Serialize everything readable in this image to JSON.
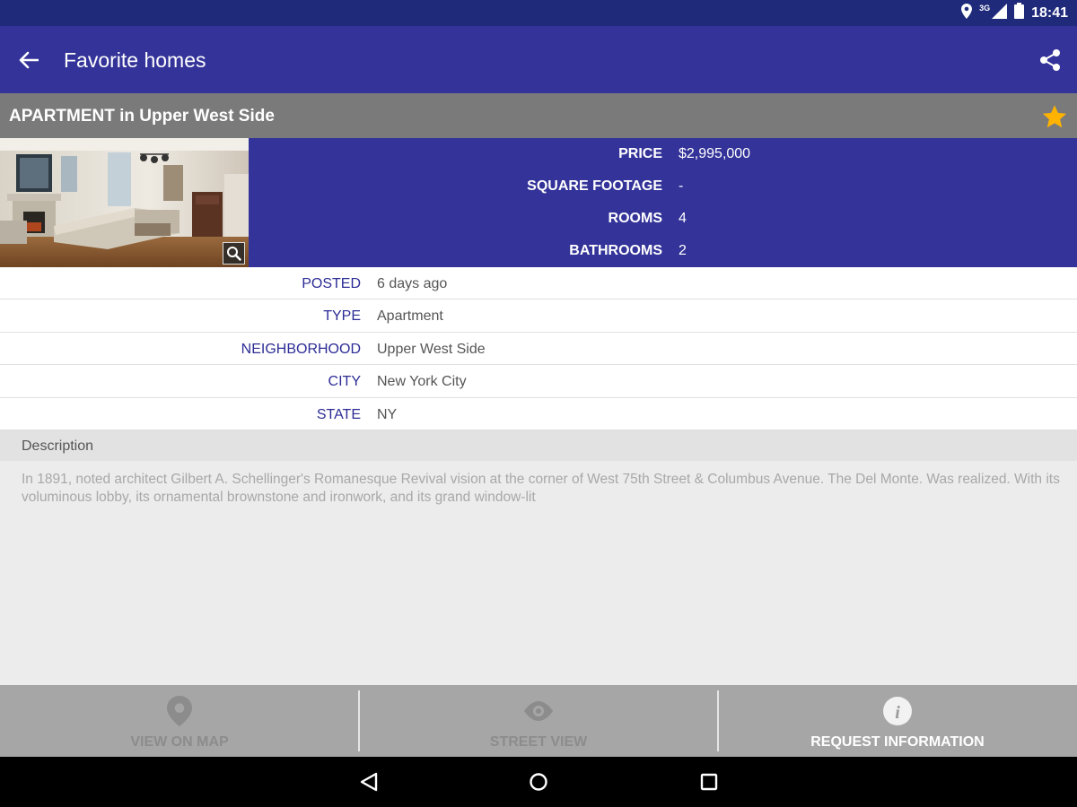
{
  "status_bar": {
    "network": "3G",
    "time": "18:41"
  },
  "app_bar": {
    "title": "Favorite homes",
    "back_icon": "arrow-back-icon",
    "share_icon": "share-icon"
  },
  "listing": {
    "title": "APARTMENT in Upper West Side",
    "favorite": true,
    "star_color": "#ffb300"
  },
  "summary": [
    {
      "label": "PRICE",
      "value": "$2,995,000"
    },
    {
      "label": "SQUARE FOOTAGE",
      "value": "-"
    },
    {
      "label": "ROOMS",
      "value": "4"
    },
    {
      "label": "BATHROOMS",
      "value": "2"
    }
  ],
  "details": [
    {
      "label": "POSTED",
      "value": "6 days ago"
    },
    {
      "label": "TYPE",
      "value": "Apartment"
    },
    {
      "label": "NEIGHBORHOOD",
      "value": "Upper West Side"
    },
    {
      "label": "CITY",
      "value": "New York City"
    },
    {
      "label": "STATE",
      "value": "NY"
    }
  ],
  "description": {
    "heading": "Description",
    "text": "In 1891, noted architect Gilbert A. Schellinger's Romanesque Revival vision at the corner of West 75th Street & Columbus Avenue. The Del Monte. Was realized. With its voluminous lobby, its ornamental brownstone and ironwork, and its grand window-lit"
  },
  "actions": [
    {
      "label": "VIEW ON MAP",
      "icon": "map-pin-icon",
      "active": false
    },
    {
      "label": "STREET VIEW",
      "icon": "eye-icon",
      "active": false
    },
    {
      "label": "REQUEST INFORMATION",
      "icon": "info-icon",
      "active": true
    }
  ],
  "colors": {
    "primary": "#333399",
    "status_bar": "#1f2a7a",
    "header_gray": "#7a7a7a",
    "label_blue": "#2c2c96"
  }
}
